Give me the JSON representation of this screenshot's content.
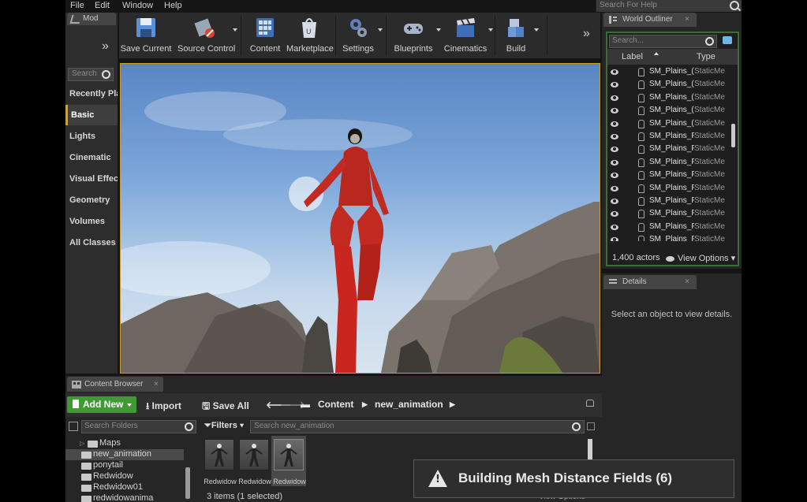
{
  "menu": [
    "File",
    "Edit",
    "Window",
    "Help"
  ],
  "help_search": "Search For Help",
  "modes": {
    "tab": "Mod",
    "search_placeholder": "Search",
    "categories": [
      "Recently Pla",
      "Basic",
      "Lights",
      "Cinematic",
      "Visual Effec",
      "Geometry",
      "Volumes",
      "All Classes"
    ],
    "selected": "Basic"
  },
  "toolbar": {
    "buttons": [
      {
        "label": "Save Current"
      },
      {
        "label": "Source Control"
      },
      {
        "label": "Content"
      },
      {
        "label": "Marketplace"
      },
      {
        "label": "Settings"
      },
      {
        "label": "Blueprints"
      },
      {
        "label": "Cinematics"
      },
      {
        "label": "Build"
      }
    ]
  },
  "outliner": {
    "tab": "World Outliner",
    "search_placeholder": "Search...",
    "col_label": "Label",
    "col_type": "Type",
    "rows": [
      {
        "name": "SM_Plains_(",
        "type": "StaticMe"
      },
      {
        "name": "SM_Plains_(",
        "type": "StaticMe"
      },
      {
        "name": "SM_Plains_(",
        "type": "StaticMe"
      },
      {
        "name": "SM_Plains_(",
        "type": "StaticMe"
      },
      {
        "name": "SM_Plains_(",
        "type": "StaticMe"
      },
      {
        "name": "SM_Plains_F",
        "type": "StaticMe"
      },
      {
        "name": "SM_Plains_F",
        "type": "StaticMe"
      },
      {
        "name": "SM_Plains_F",
        "type": "StaticMe"
      },
      {
        "name": "SM_Plains_F",
        "type": "StaticMe"
      },
      {
        "name": "SM_Plains_F",
        "type": "StaticMe"
      },
      {
        "name": "SM_Plains_F",
        "type": "StaticMe"
      },
      {
        "name": "SM_Plains_F",
        "type": "StaticMe"
      },
      {
        "name": "SM_Plains_F",
        "type": "StaticMe"
      },
      {
        "name": "SM_Plains_F",
        "type": "StaticMe"
      }
    ],
    "actors": "1,400 actors",
    "view_options": "View Options"
  },
  "details": {
    "tab": "Details",
    "message": "Select an object to view details."
  },
  "content_browser": {
    "tab": "Content Browser",
    "add_new": "Add New",
    "import": "Import",
    "save_all": "Save All",
    "breadcrumb": [
      "Content",
      "new_animation"
    ],
    "folder_search": "Search Folders",
    "filters": "Filters",
    "asset_search": "Search new_animation",
    "folders": [
      {
        "name": "Maps",
        "expandable": true
      },
      {
        "name": "new_animation",
        "selected": true
      },
      {
        "name": "ponytail"
      },
      {
        "name": "Redwidow"
      },
      {
        "name": "Redwidow01"
      },
      {
        "name": "redwidowanima"
      }
    ],
    "assets": [
      "Redwidow",
      "Redwidow",
      "Redwidow"
    ],
    "count": "3 items (1 selected)",
    "view_options": "View Options"
  },
  "toast": {
    "message": "Building Mesh Distance Fields (6)"
  }
}
